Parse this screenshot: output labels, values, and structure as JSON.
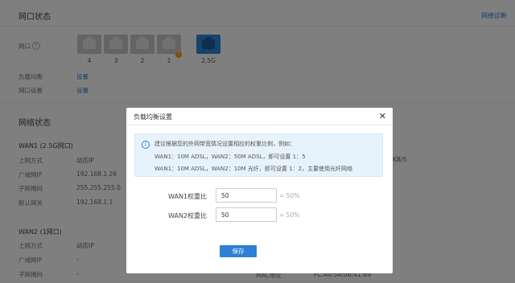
{
  "port_status": {
    "title": "网口状态",
    "diagnose_link": "网络诊断",
    "port_label": "网口",
    "help_icon": "question-icon",
    "ports": [
      {
        "label": "4",
        "active": false
      },
      {
        "label": "3",
        "active": false
      },
      {
        "label": "2",
        "active": false
      },
      {
        "label": "1",
        "active": false,
        "warning": true
      },
      {
        "label": "2.5G",
        "active": true
      }
    ],
    "warning_badge": "!",
    "load_balance_label": "负载均衡",
    "load_balance_link": "设置",
    "port_settings_label": "网口设置",
    "port_settings_link": "设置",
    "active_color": "#2e86d8"
  },
  "network_status": {
    "title": "网络状态",
    "wan1": {
      "title": "WAN1 (2.5G网口)",
      "rows": [
        {
          "label": "上网方式",
          "value": "动态IP"
        },
        {
          "label": "广域网IP",
          "value": "192.168.1.26"
        },
        {
          "label": "子网掩码",
          "value": "255.255.255.0"
        },
        {
          "label": "默认网关",
          "value": "192.168.1.1"
        }
      ],
      "side_value": "KB/S"
    },
    "wan2": {
      "title": "WAN2 (1网口)",
      "rows": [
        {
          "label": "上网方式",
          "value": "动态IP"
        },
        {
          "label": "广域网IP",
          "value": "-"
        },
        {
          "label": "子网掩码",
          "value": "-"
        }
      ],
      "side_text": "MAC地址",
      "side_value": "FC:A0:5A:0B:41:B9"
    }
  },
  "modal": {
    "title": "负载均衡设置",
    "close_icon": "close-icon",
    "info_icon": "info-icon",
    "info_lines": [
      "建议根据您的外网带宽情况设置相应的权重比例，例如：",
      "WAN1：10M ADSL，WAN2：50M ADSL，即可设置 1：5",
      "WAN1：10M ADSL，WAN2：10M 光纤，即可设置 1：2，主要使用光纤网络"
    ],
    "fields": [
      {
        "label": "WAN1权重比",
        "value": "50",
        "suffix": "= 50%"
      },
      {
        "label": "WAN2权重比",
        "value": "50",
        "suffix": "= 50%"
      }
    ],
    "save_label": "保存",
    "accent_color": "#2f7fd4"
  }
}
